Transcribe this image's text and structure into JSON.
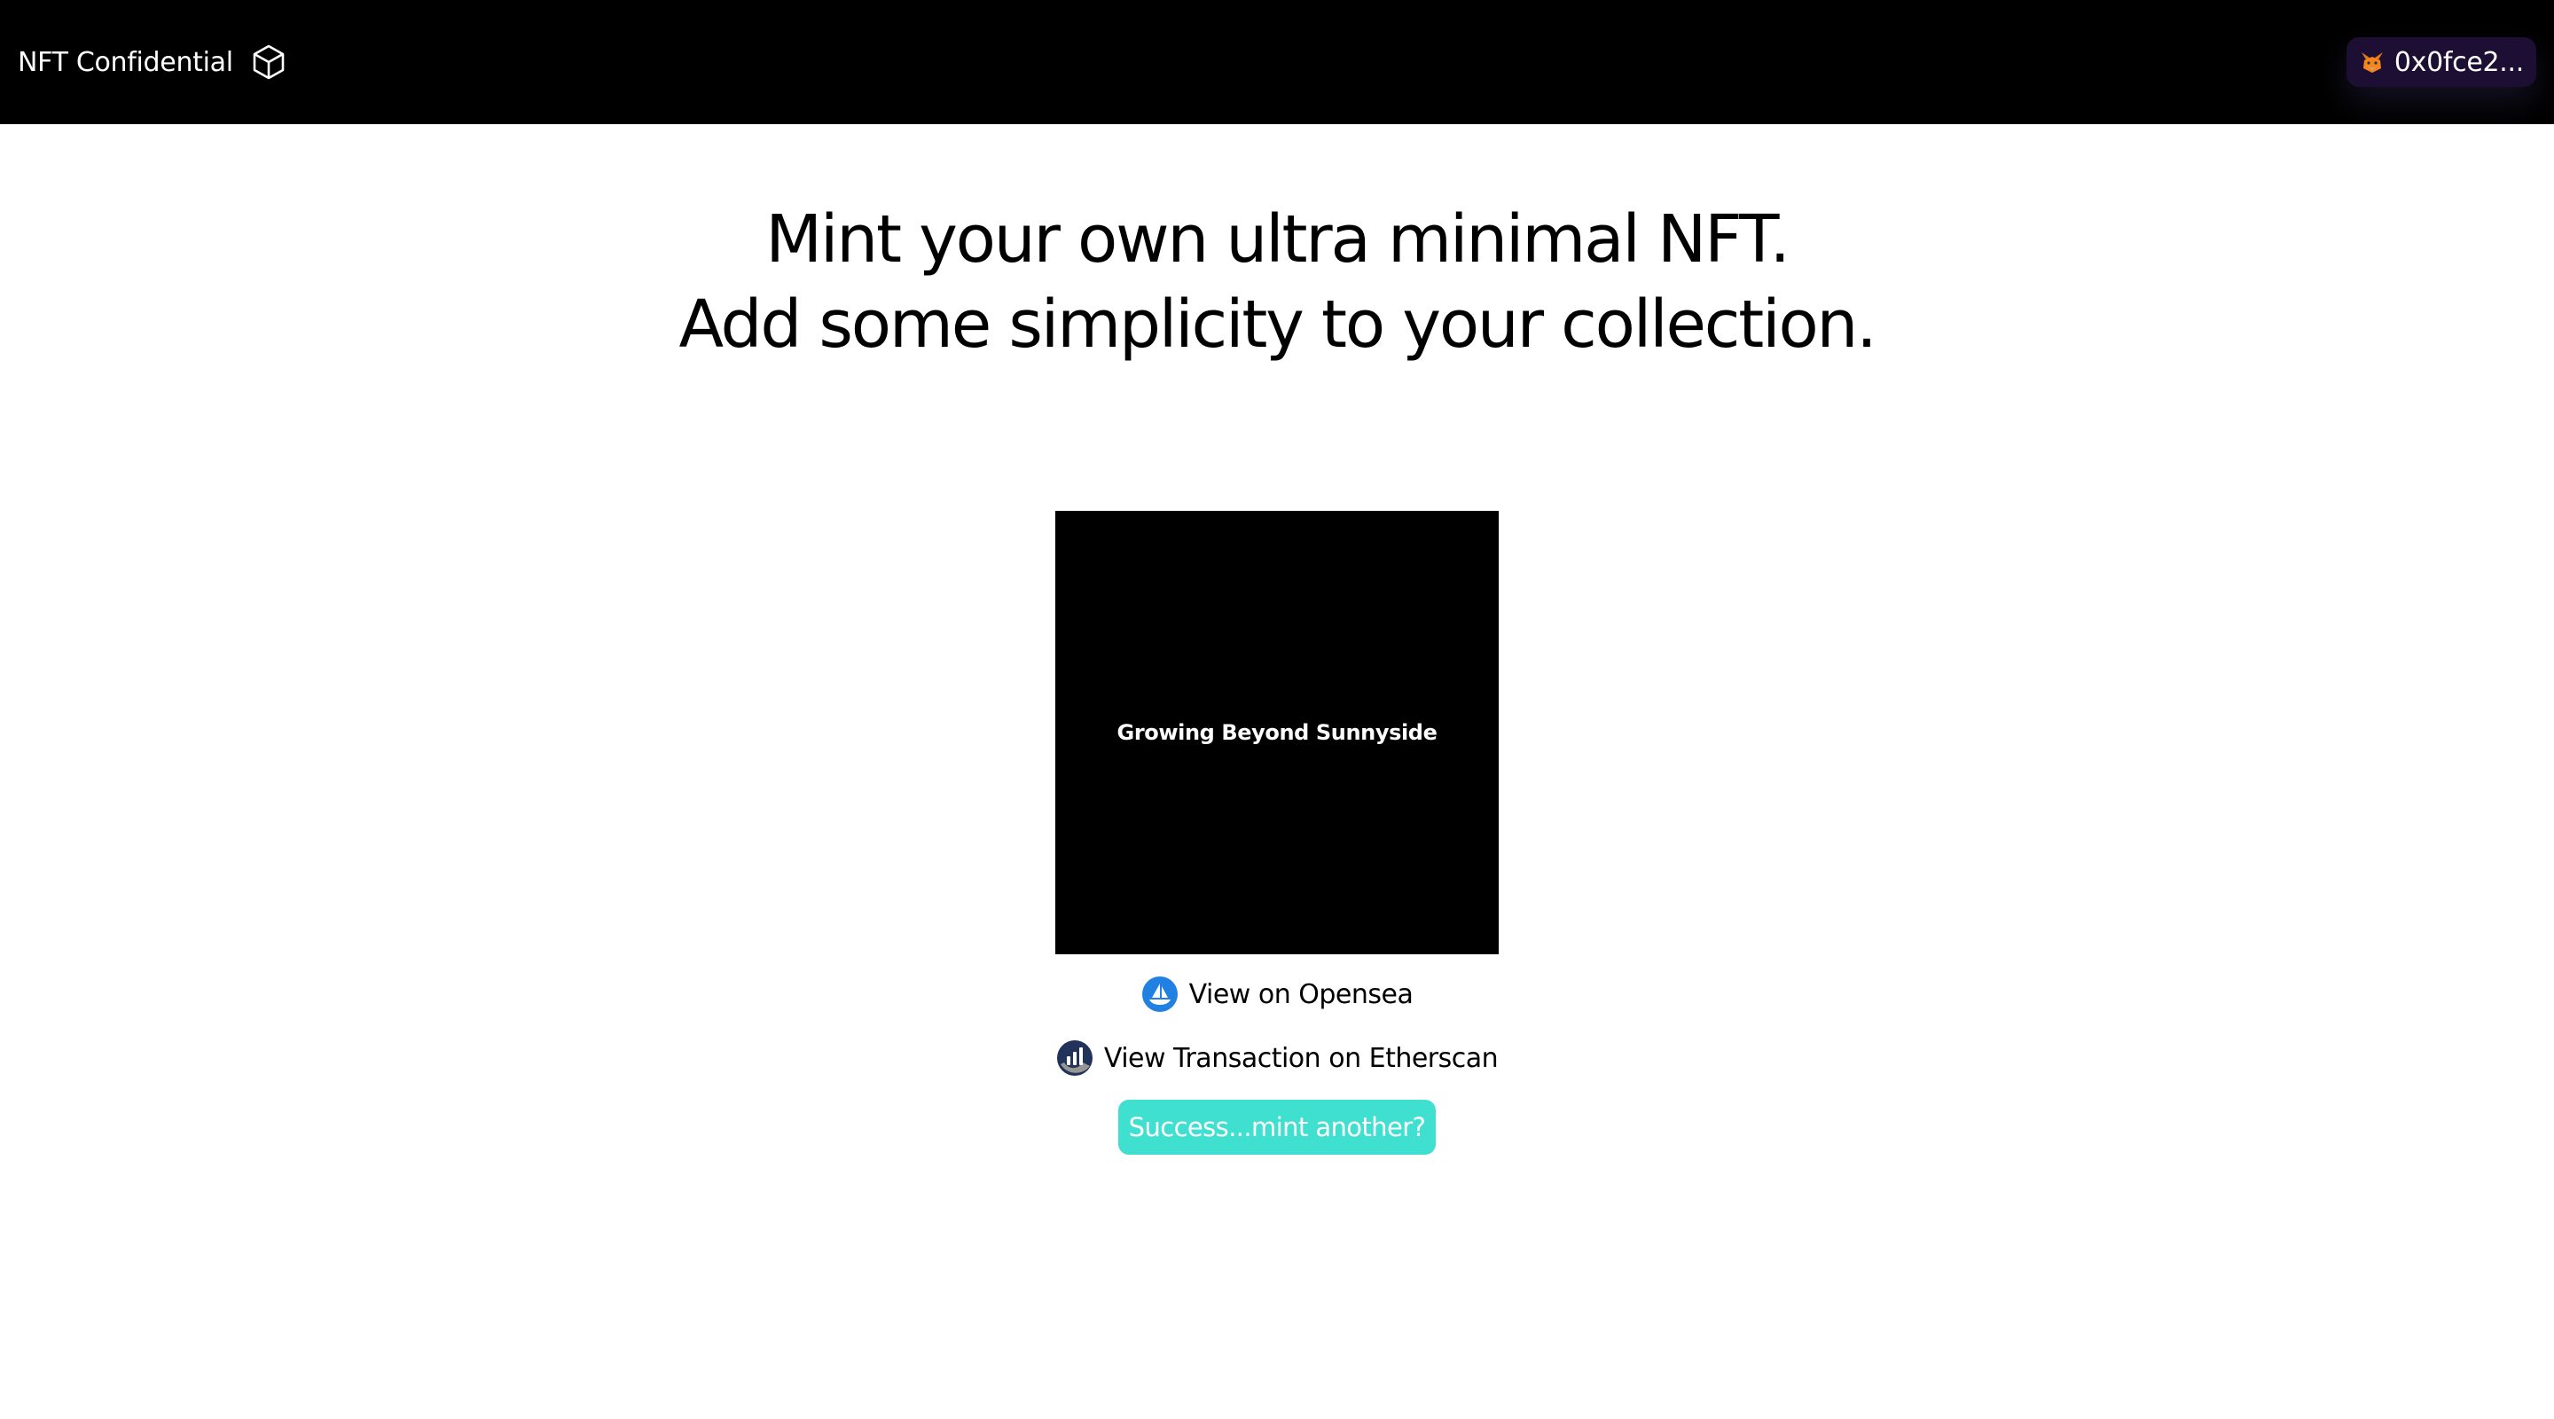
{
  "header": {
    "brand_name": "NFT Confidential",
    "brand_icon": "cube-icon",
    "wallet": {
      "icon": "metamask-fox-icon",
      "address": "0x0fce2..."
    }
  },
  "hero": {
    "line1": "Mint your own ultra minimal NFT.",
    "line2": "Add some simplicity to your collection."
  },
  "nft": {
    "text": "Growing Beyond Sunnyside"
  },
  "links": {
    "opensea": {
      "icon": "opensea-icon",
      "label": "View on Opensea"
    },
    "etherscan": {
      "icon": "etherscan-icon",
      "label": "View Transaction on Etherscan"
    }
  },
  "mint_button": {
    "label": "Success...mint another?"
  },
  "colors": {
    "topbar": "#000000",
    "wallet_bg": "#1d0f33",
    "accent_teal": "#40e0d0",
    "opensea_blue": "#2081e2",
    "etherscan_navy": "#21325b"
  }
}
